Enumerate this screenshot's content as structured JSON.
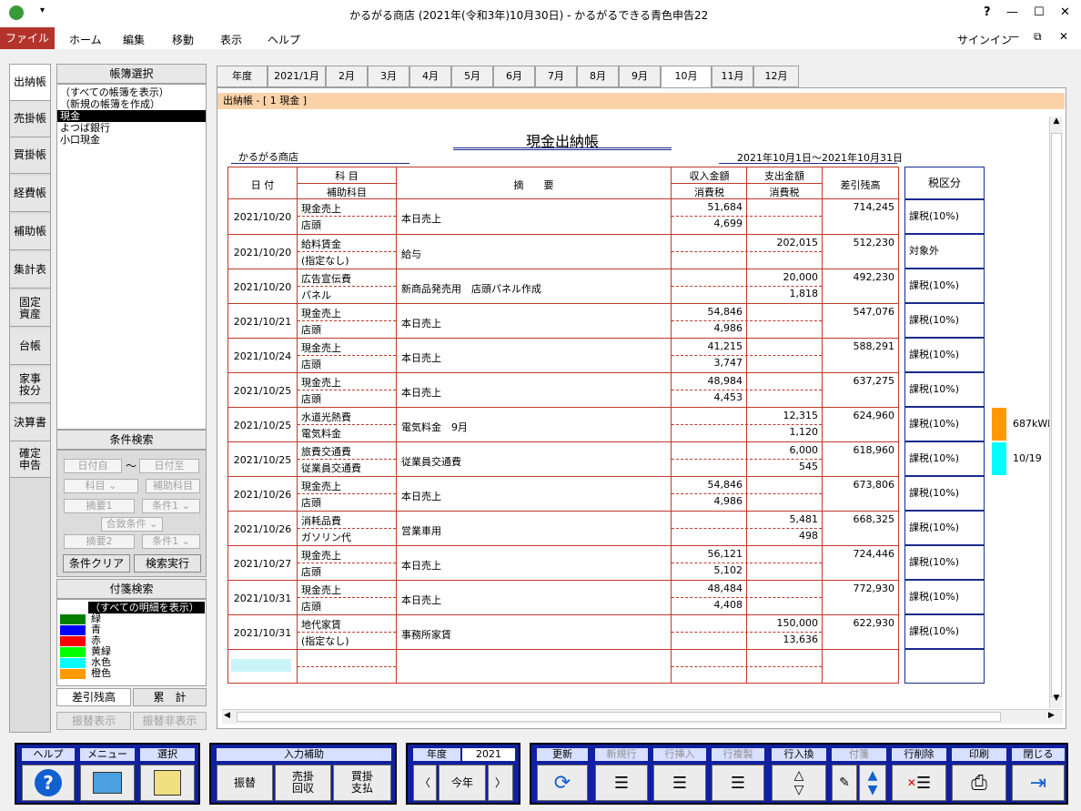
{
  "window": {
    "title": "かるがる商店 (2021年(令和3年)10月30日) - かるがるできる青色申告22",
    "help": "?",
    "minimize": "—",
    "maximize": "☐",
    "close": "✕"
  },
  "menu": {
    "file": "ファイル",
    "home": "ホーム",
    "edit": "編集",
    "move": "移動",
    "view": "表示",
    "help": "ヘルプ",
    "signin": "サインイン"
  },
  "nav": [
    "出納帳",
    "売掛帳",
    "買掛帳",
    "経費帳",
    "補助帳",
    "集計表",
    "固定\n資産",
    "台帳",
    "家事\n按分",
    "決算書",
    "確定\n申告"
  ],
  "book_select": {
    "header": "帳簿選択",
    "items": [
      "（すべての帳簿を表示）",
      "（新規の帳簿を作成）",
      "現金",
      "よつば銀行",
      "小口現金"
    ],
    "selected_index": 2
  },
  "cond_search": {
    "header": "条件検索",
    "date_from": "日付自",
    "tilde": "〜",
    "date_to": "日付至",
    "account": "科目",
    "sub_account": "補助科目",
    "desc1": "摘要1",
    "cond1": "条件1",
    "match": "合致条件",
    "desc2": "摘要2",
    "cond2": "条件1",
    "clear": "条件クリア",
    "run": "検索実行"
  },
  "tag_search": {
    "header": "付箋検索",
    "all": "（すべての明細を表示）",
    "tags": [
      {
        "label": "緑",
        "color": "#008000"
      },
      {
        "label": "青",
        "color": "#0000ff"
      },
      {
        "label": "赤",
        "color": "#ff0000"
      },
      {
        "label": "黄緑",
        "color": "#00ff00"
      },
      {
        "label": "水色",
        "color": "#00ffff"
      },
      {
        "label": "橙色",
        "color": "#ff9900"
      }
    ]
  },
  "bottom_left": {
    "balance_tab": "差引残高",
    "total_tab": "累　計",
    "transfer_show": "振替表示",
    "transfer_hide": "振替非表示"
  },
  "tabs": [
    "年度",
    "2021/1月",
    "2月",
    "3月",
    "4月",
    "5月",
    "6月",
    "7月",
    "8月",
    "9月",
    "10月",
    "11月",
    "12月"
  ],
  "active_tab": "10月",
  "breadcrumb": "出納帳 - [ 1 現金 ]",
  "ledger": {
    "title": "現金出納帳",
    "shop": "かるがる商店",
    "period": "2021年10月1日～2021年10月31日",
    "headers": {
      "date": "日 付",
      "account": "科 目",
      "sub_account": "補助科目",
      "desc": "摘　　要",
      "income": "収入金額",
      "expense": "支出金額",
      "tax": "消費税",
      "balance": "差引残高",
      "tax_class": "税区分"
    },
    "rows": [
      {
        "date": "2021/10/20",
        "account": "現金売上",
        "sub": "店頭",
        "desc": "本日売上",
        "income": "51,684",
        "income_tax": "4,699",
        "expense": "",
        "expense_tax": "",
        "balance": "714,245",
        "tax_class": "課税(10%)"
      },
      {
        "date": "2021/10/20",
        "account": "給料賃金",
        "sub": "(指定なし)",
        "desc": "給与",
        "income": "",
        "income_tax": "",
        "expense": "202,015",
        "expense_tax": "",
        "balance": "512,230",
        "tax_class": "対象外"
      },
      {
        "date": "2021/10/20",
        "account": "広告宣伝費",
        "sub": "パネル",
        "desc": "新商品発売用　店頭パネル作成",
        "income": "",
        "income_tax": "",
        "expense": "20,000",
        "expense_tax": "1,818",
        "balance": "492,230",
        "tax_class": "課税(10%)"
      },
      {
        "date": "2021/10/21",
        "account": "現金売上",
        "sub": "店頭",
        "desc": "本日売上",
        "income": "54,846",
        "income_tax": "4,986",
        "expense": "",
        "expense_tax": "",
        "balance": "547,076",
        "tax_class": "課税(10%)"
      },
      {
        "date": "2021/10/24",
        "account": "現金売上",
        "sub": "店頭",
        "desc": "本日売上",
        "income": "41,215",
        "income_tax": "3,747",
        "expense": "",
        "expense_tax": "",
        "balance": "588,291",
        "tax_class": "課税(10%)"
      },
      {
        "date": "2021/10/25",
        "account": "現金売上",
        "sub": "店頭",
        "desc": "本日売上",
        "income": "48,984",
        "income_tax": "4,453",
        "expense": "",
        "expense_tax": "",
        "balance": "637,275",
        "tax_class": "課税(10%)"
      },
      {
        "date": "2021/10/25",
        "account": "水道光熱費",
        "sub": "電気料金",
        "desc": "電気料金　9月",
        "income": "",
        "income_tax": "",
        "expense": "12,315",
        "expense_tax": "1,120",
        "balance": "624,960",
        "tax_class": "課税(10%)"
      },
      {
        "date": "2021/10/25",
        "account": "旅費交通費",
        "sub": "従業員交通費",
        "desc": "従業員交通費",
        "income": "",
        "income_tax": "",
        "expense": "6,000",
        "expense_tax": "545",
        "balance": "618,960",
        "tax_class": "課税(10%)"
      },
      {
        "date": "2021/10/26",
        "account": "現金売上",
        "sub": "店頭",
        "desc": "本日売上",
        "income": "54,846",
        "income_tax": "4,986",
        "expense": "",
        "expense_tax": "",
        "balance": "673,806",
        "tax_class": "課税(10%)"
      },
      {
        "date": "2021/10/26",
        "account": "消耗品費",
        "sub": "ガソリン代",
        "desc": "営業車用",
        "income": "",
        "income_tax": "",
        "expense": "5,481",
        "expense_tax": "498",
        "balance": "668,325",
        "tax_class": "課税(10%)"
      },
      {
        "date": "2021/10/27",
        "account": "現金売上",
        "sub": "店頭",
        "desc": "本日売上",
        "income": "56,121",
        "income_tax": "5,102",
        "expense": "",
        "expense_tax": "",
        "balance": "724,446",
        "tax_class": "課税(10%)"
      },
      {
        "date": "2021/10/31",
        "account": "現金売上",
        "sub": "店頭",
        "desc": "本日売上",
        "income": "48,484",
        "income_tax": "4,408",
        "expense": "",
        "expense_tax": "",
        "balance": "772,930",
        "tax_class": "課税(10%)"
      },
      {
        "date": "2021/10/31",
        "account": "地代家賃",
        "sub": "(指定なし)",
        "desc": "事務所家賃",
        "income": "",
        "income_tax": "",
        "expense": "150,000",
        "expense_tax": "13,636",
        "balance": "622,930",
        "tax_class": "課税(10%)"
      }
    ]
  },
  "sticky_notes": [
    {
      "color": "#ff9900",
      "text": "687kWh"
    },
    {
      "color": "#00ffff",
      "text": "10/19"
    }
  ],
  "toolbar": {
    "help": "ヘルプ",
    "menu": "メニュー",
    "select": "選択",
    "input_assist": "入力補助",
    "transfer": "振替",
    "receivable": "売掛\n回収",
    "payable": "買掛\n支払",
    "year_label": "年度",
    "year_value": "2021",
    "this_year": "今年",
    "refresh": "更新",
    "new_row": "新規行",
    "insert_row": "行挿入",
    "copy_row": "行複製",
    "swap_row": "行入換",
    "tag": "付箋",
    "delete_row": "行削除",
    "print": "印刷",
    "close": "閉じる"
  }
}
